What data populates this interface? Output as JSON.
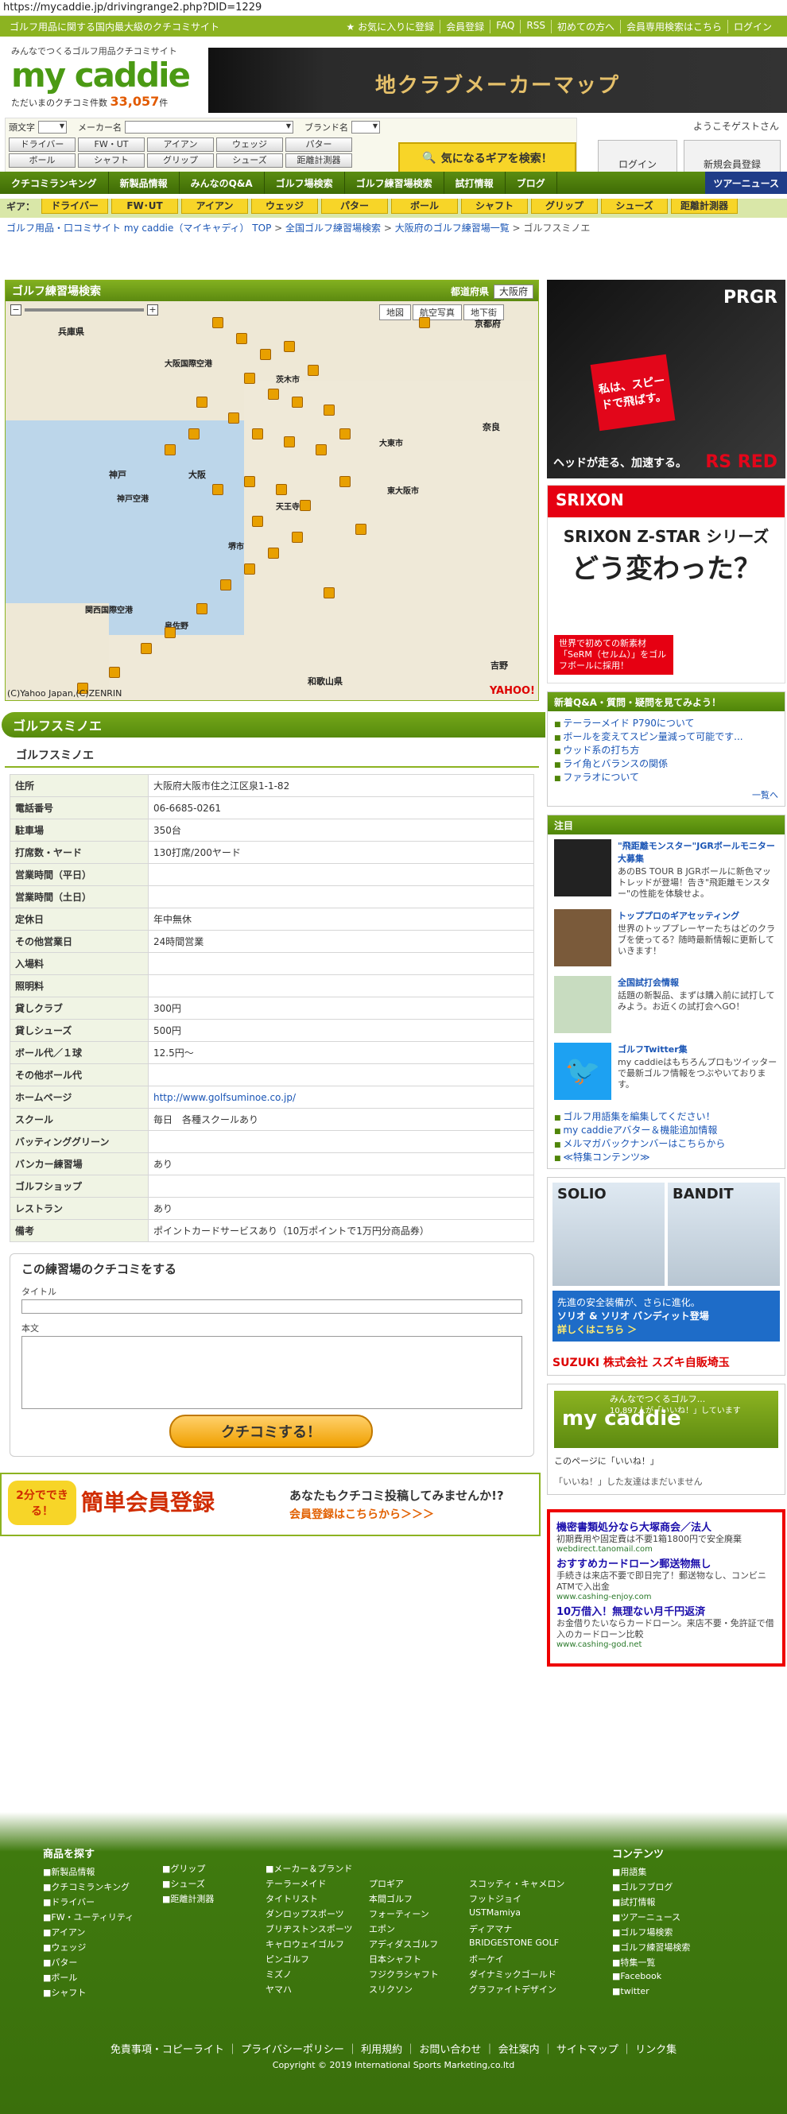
{
  "url": "https://mycaddie.jp/drivingrange2.php?DID=1229",
  "top": {
    "tagline": "ゴルフ用品に関する国内最大級のクチコミサイト",
    "links": [
      "★ お気に入りに登録",
      "会員登録",
      "FAQ",
      "RSS",
      "初めての方へ",
      "会員専用検索はこちら",
      "ログイン"
    ]
  },
  "logo": {
    "tagline": "みんなでつくるゴルフ用品クチコミサイト",
    "name": "my caddie",
    "count_label": "ただいまのクチコミ件数",
    "count": "33,057",
    "count_unit": "件"
  },
  "hbanner": {
    "text": "地クラブメーカーマップ"
  },
  "search": {
    "label_head": "頭文字",
    "label_maker": "メーカー名",
    "label_brand": "ブランド名",
    "buttons_row1": [
      "ドライバー",
      "FW・UT",
      "アイアン",
      "ウェッジ",
      "パター"
    ],
    "buttons_row2": [
      "ボール",
      "シャフト",
      "グリップ",
      "シューズ",
      "距離計測器"
    ],
    "search_button": "気になるギアを検索！"
  },
  "welcome": "ようこそゲストさん",
  "login": "ログイン",
  "register": "新規会員登録",
  "nav": [
    "クチコミランキング",
    "新製品情報",
    "みんなのQ&A",
    "ゴルフ場検索",
    "ゴルフ練習場検索",
    "試打情報",
    "ブログ"
  ],
  "nav_tour": "ツアーニュース",
  "gearbar": {
    "label": "ギア：",
    "items": [
      "ドライバー",
      "FW･UT",
      "アイアン",
      "ウェッジ",
      "パター",
      "ボール",
      "シャフト",
      "グリップ",
      "シューズ",
      "距離計測器"
    ]
  },
  "breadcrumb": [
    "ゴルフ用品・口コミサイト my caddie（マイキャディ） TOP",
    "全国ゴルフ練習場検索",
    "大阪府のゴルフ練習場一覧",
    "ゴルフスミノエ"
  ],
  "map": {
    "title": "ゴルフ練習場検索",
    "pref_label": "都道府県",
    "pref": "大阪府",
    "controls": [
      "地図",
      "航空写真",
      "地下街"
    ],
    "cities": [
      "兵庫県",
      "大阪国際空港",
      "奈良",
      "京都府",
      "大阪",
      "神戸",
      "神戸空港",
      "大東市",
      "東大阪市",
      "堺市",
      "泉佐野",
      "和歌山県",
      "関西国際空港",
      "天王寺",
      "茨木市",
      "吉野"
    ],
    "copyright": "(C)Yahoo Japan,(C)ZENRIN",
    "yahoo": "YAHOO!"
  },
  "section_title": "ゴルフスミノエ",
  "sub_title": "ゴルフスミノエ",
  "info": [
    {
      "k": "住所",
      "v": "大阪府大阪市住之江区泉1-1-82"
    },
    {
      "k": "電話番号",
      "v": "06-6685-0261"
    },
    {
      "k": "駐車場",
      "v": "350台"
    },
    {
      "k": "打席数・ヤード",
      "v": "130打席/200ヤード"
    },
    {
      "k": "営業時間（平日）",
      "v": ""
    },
    {
      "k": "営業時間（土日）",
      "v": ""
    },
    {
      "k": "定休日",
      "v": "年中無休"
    },
    {
      "k": "その他営業日",
      "v": "24時間営業"
    },
    {
      "k": "入場料",
      "v": ""
    },
    {
      "k": "照明料",
      "v": ""
    },
    {
      "k": "貸しクラブ",
      "v": "300円"
    },
    {
      "k": "貸しシューズ",
      "v": "500円"
    },
    {
      "k": "ボール代／１球",
      "v": "12.5円～"
    },
    {
      "k": "その他ボール代",
      "v": ""
    },
    {
      "k": "ホームページ",
      "v": "http://www.golfsuminoe.co.jp/"
    },
    {
      "k": "スクール",
      "v": "毎日　各種スクールあり"
    },
    {
      "k": "バッティンググリーン",
      "v": ""
    },
    {
      "k": "バンカー練習場",
      "v": "あり"
    },
    {
      "k": "ゴルフショップ",
      "v": ""
    },
    {
      "k": "レストラン",
      "v": "あり"
    },
    {
      "k": "備考",
      "v": "ポイントカードサービスあり（10万ポイントで1万円分商品券）"
    }
  ],
  "review": {
    "title": "この練習場のクチコミをする",
    "title_label": "タイトル",
    "body_label": "本文",
    "submit": "クチコミする！"
  },
  "regbanner": {
    "badge": "2分でできる！",
    "main": "簡単会員登録",
    "q": "あなたもクチコミ投稿してみませんか!?",
    "link": "会員登録はこちらから＞＞＞"
  },
  "ad1": {
    "brand": "PRGR",
    "flag": "私は、スピードで飛ばす。",
    "bottom": "ヘッドが走る、加速する。",
    "model": "RS RED"
  },
  "ad2": {
    "brand": "SRIXON",
    "title": "SRIXON Z-STAR シリーズ",
    "big": "どう変わった？",
    "note": "世界で初めての新素材「SeRM（セルム）」をゴルフボールに採用！"
  },
  "qa": {
    "title": "新着Q&A・質問・疑問を見てみよう！",
    "items": [
      "テーラーメイド P790について",
      "ボールを変えてスピン量減って可能です...",
      "ウッド系の打ち方",
      "ライ角とバランスの関係",
      "ファラオについて"
    ],
    "more": "一覧へ"
  },
  "notes": {
    "title": "注目",
    "items": [
      {
        "t": "\"飛距離モンスター\"JGRボールモニター大募集",
        "d": "あのBS TOUR B JGRボールに新色マットレッドが登場！告き\"飛距離モンスター\"の性能を体験せよ。"
      },
      {
        "t": "トッププロのギアセッティング",
        "d": "世界のトッププレーヤーたちはどのクラブを使ってる？随時最新情報に更新していきます！"
      },
      {
        "t": "全国試打会情報",
        "d": "話題の新製品、まずは購入前に試打してみよう。お近くの試打会へGO！"
      },
      {
        "t": "ゴルフTwitter集",
        "d": "my caddieはもちろんプロもツイッターで最新ゴルフ情報をつぶやいております。"
      }
    ],
    "links": [
      "ゴルフ用語集を編集してください！",
      "my caddieアバター＆機能追加情報",
      "メルマガバックナンバーはこちらから",
      "≪特集コンテンツ≫"
    ]
  },
  "ad3": {
    "car1": "SOLIO",
    "car2": "BANDIT",
    "line1": "先進の安全装備が、さらに進化。",
    "line2": "ソリオ & ソリオ バンディット登場",
    "line3": "詳しくはこちら ＞",
    "maker": "SUZUKI 株式会社 スズキ自販埼玉"
  },
  "fb": {
    "tag": "みんなでつくるゴルフ...",
    "likes": "10,897人が「いいね！」しています",
    "name": "my caddie",
    "like_btn": "このページに「いいね！」",
    "nofriends": "「いいね！」した友達はまだいません"
  },
  "gad": [
    {
      "t": "機密書類処分なら大塚商会／法人",
      "d": "初期費用や固定費は不要1箱1800円で安全廃棄",
      "u": "webdirect.tanomail.com"
    },
    {
      "t": "おすすめカードローン郵送物無し",
      "d": "手続きは来店不要で即日完了！郵送物なし、コンビニATMで入出金",
      "u": "www.cashing-enjoy.com"
    },
    {
      "t": "10万借入！無理ない月千円返済",
      "d": "お金借りたいならカードローン。来店不要・免許証で借入のカードローン比較",
      "u": "www.cashing-god.net"
    }
  ],
  "footer": {
    "h1": "商品を探す",
    "h2": "コンテンツ",
    "col1": [
      "■新製品情報",
      "■クチコミランキング",
      "■ドライバー",
      "■FW・ユーティリティ",
      "■アイアン",
      "■ウェッジ",
      "■パター",
      "■ボール",
      "■シャフト"
    ],
    "col2": [
      "■グリップ",
      "■シューズ",
      "■距離計測器"
    ],
    "col3": [
      "■メーカー＆ブランド",
      "テーラーメイド",
      "タイトリスト",
      "ダンロップスポーツ",
      "ブリヂストンスポーツ",
      "キャロウェイゴルフ",
      "ピンゴルフ",
      "ミズノ",
      "ヤマハ"
    ],
    "col4": [
      "",
      "プロギア",
      "本間ゴルフ",
      "フォーティーン",
      "エポン",
      "アディダスゴルフ",
      "日本シャフト",
      "フジクラシャフト",
      "スリクソン"
    ],
    "col5": [
      "",
      "スコッティ・キャメロン",
      "フットジョイ",
      "USTMamiya",
      "ディアマナ",
      "BRIDGESTONE GOLF",
      "ボーケイ",
      "ダイナミックゴールド",
      "グラファイトデザイン"
    ],
    "col6": [
      "■用語集",
      "■ゴルフブログ",
      "■試打情報",
      "■ツアーニュース",
      "■ゴルフ場検索",
      "■ゴルフ練習場検索",
      "■特集一覧",
      "■Facebook",
      "■twitter"
    ],
    "links": "免責事項・コピーライト ｜ プライバシーポリシー ｜ 利用規約 ｜ お問い合わせ ｜ 会社案内 ｜ サイトマップ ｜ リンク集",
    "copy": "Copyright © 2019 International Sports Marketing,co.ltd"
  }
}
